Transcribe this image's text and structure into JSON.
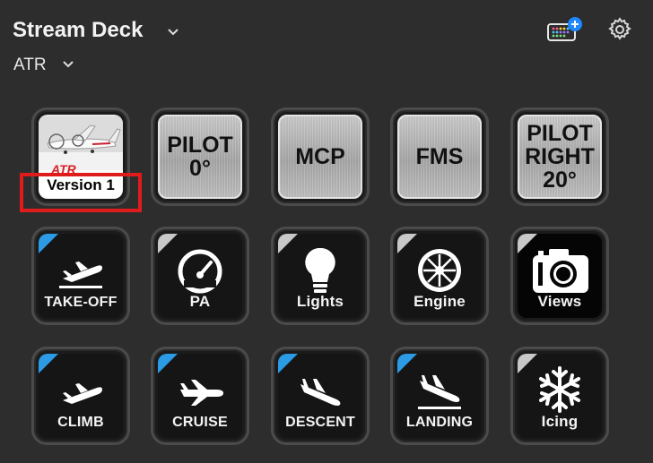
{
  "header": {
    "title": "Stream Deck",
    "profile": "ATR"
  },
  "icons": {
    "title_dropdown": "chevron-down-icon",
    "profile_dropdown": "chevron-down-icon",
    "store": "store-plus-icon",
    "settings": "gear-icon"
  },
  "keys": {
    "version": {
      "label": "Version 1",
      "logo_text": "ATR"
    },
    "pilot0": {
      "text": "PILOT\n0°"
    },
    "mcp": {
      "text": "MCP"
    },
    "fms": {
      "text": "FMS"
    },
    "pilot_right": {
      "text": "PILOT\nRIGHT\n20°"
    },
    "takeoff": {
      "label": "TAKE-OFF"
    },
    "pa": {
      "label": "PA"
    },
    "lights": {
      "label": "Lights"
    },
    "engine": {
      "label": "Engine"
    },
    "views": {
      "label": "Views"
    },
    "climb": {
      "label": "CLIMB"
    },
    "cruise": {
      "label": "CRUISE"
    },
    "descent": {
      "label": "DESCENT"
    },
    "landing": {
      "label": "LANDING"
    },
    "icing": {
      "label": "Icing"
    }
  },
  "colors": {
    "background": "#2d2d2d",
    "highlight": "#e01b1b",
    "blue_corner": "#2b9be6",
    "store_badge": "#1e88ff"
  }
}
